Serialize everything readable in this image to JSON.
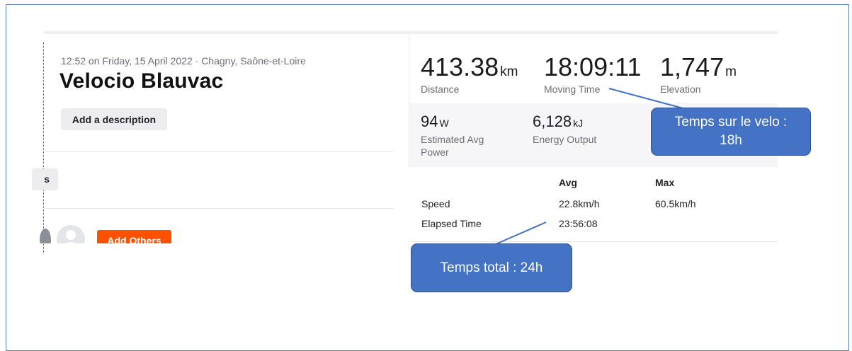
{
  "activity": {
    "meta": "12:52 on Friday, 15 April 2022 · Chagny, Saône-et-Loire",
    "title": "Velocio Blauvac",
    "add_description": "Add a description",
    "clipped_button_text": "s",
    "add_others": "Add Others"
  },
  "stats": {
    "distance": {
      "value": "413.38",
      "unit": "km",
      "label": "Distance"
    },
    "moving_time": {
      "value": "18:09:11",
      "unit": "",
      "label": "Moving Time"
    },
    "elevation": {
      "value": "1,747",
      "unit": "m",
      "label": "Elevation"
    }
  },
  "secondary_stats": {
    "power": {
      "value": "94",
      "unit": "W",
      "label_line1": "Estimated Avg",
      "label_line2": "Power"
    },
    "energy": {
      "value": "6,128",
      "unit": "kJ",
      "label": "Energy Output"
    }
  },
  "table": {
    "headers": {
      "avg": "Avg",
      "max": "Max"
    },
    "rows": [
      {
        "label": "Speed",
        "avg": "22.8km/h",
        "max": "60.5km/h"
      },
      {
        "label": "Elapsed Time",
        "avg": "23:56:08",
        "max": ""
      }
    ]
  },
  "callouts": {
    "moving_line1": "Temps sur le velo :",
    "moving_line2": "18h",
    "total": "Temps total : 24h"
  },
  "colors": {
    "accent_orange": "#fc5200",
    "callout_blue": "#4472c4",
    "frame_border": "#5b7fb5"
  }
}
